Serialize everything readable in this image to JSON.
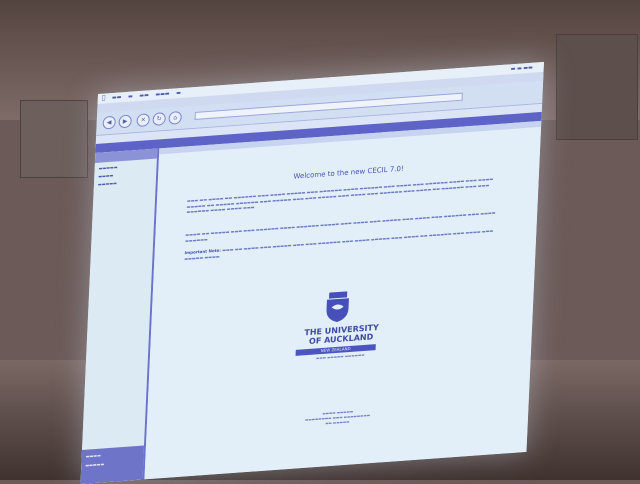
{
  "welcome_heading": "Welcome to the new CECIL 7.0!",
  "university": {
    "name_line1": "THE UNIVERSITY",
    "name_line2": "OF AUCKLAND",
    "bar_text": "NEW ZEALAND"
  },
  "paragraphs": {
    "important_label": "Important Note:"
  },
  "colors": {
    "banner": "#5e63c8",
    "heading": "#4650b8",
    "screen": "#d9e8f6"
  }
}
